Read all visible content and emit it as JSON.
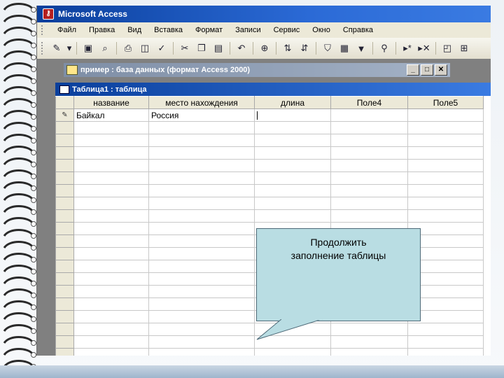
{
  "app": {
    "title": "Microsoft Access"
  },
  "menu": [
    "Файл",
    "Правка",
    "Вид",
    "Вставка",
    "Формат",
    "Записи",
    "Сервис",
    "Окно",
    "Справка"
  ],
  "toolbar": [
    "view-icon",
    "dropdown-icon",
    "save-icon",
    "find-icon",
    "print-icon",
    "preview-icon",
    "spelling-icon",
    "cut-icon",
    "copy-icon",
    "paste-icon",
    "undo-icon",
    "hyperlink-icon",
    "sort-asc-icon",
    "sort-desc-icon",
    "filter-selection-icon",
    "filter-form-icon",
    "apply-filter-icon",
    "find-binoculars-icon",
    "new-record-icon",
    "delete-record-icon",
    "database-window-icon",
    "new-object-icon"
  ],
  "db_window": {
    "title": "пример : база данных (формат Access 2000)"
  },
  "table_window": {
    "title": "Таблица1 : таблица",
    "columns": [
      "название",
      "место нахождения",
      "длина",
      "Поле4",
      "Поле5"
    ],
    "rows": [
      [
        "Байкал",
        "Россия",
        "",
        "",
        ""
      ]
    ],
    "row_selector_current": "✎",
    "row_selector_new": "*"
  },
  "callout": {
    "line1": "Продолжить",
    "line2": "заполнение таблицы"
  }
}
